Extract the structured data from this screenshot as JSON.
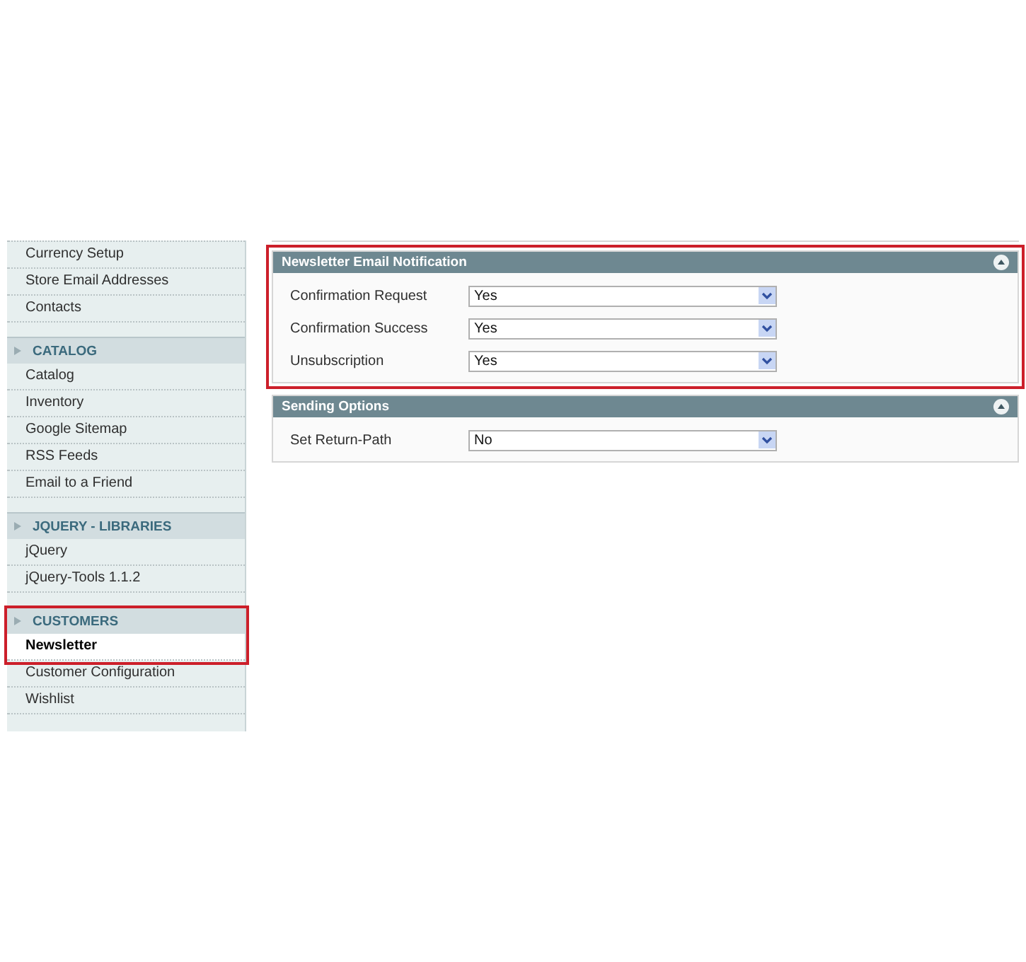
{
  "sidebar": {
    "groups": [
      {
        "items": [
          {
            "label": "Currency Setup",
            "selected": false
          },
          {
            "label": "Store Email Addresses",
            "selected": false
          },
          {
            "label": "Contacts",
            "selected": false
          }
        ]
      },
      {
        "title": "CATALOG",
        "highlighted": false,
        "items": [
          {
            "label": "Catalog",
            "selected": false
          },
          {
            "label": "Inventory",
            "selected": false
          },
          {
            "label": "Google Sitemap",
            "selected": false
          },
          {
            "label": "RSS Feeds",
            "selected": false
          },
          {
            "label": "Email to a Friend",
            "selected": false
          }
        ]
      },
      {
        "title": "JQUERY - LIBRARIES",
        "highlighted": false,
        "items": [
          {
            "label": "jQuery",
            "selected": false
          },
          {
            "label": "jQuery-Tools 1.1.2",
            "selected": false
          }
        ]
      },
      {
        "title": "CUSTOMERS",
        "highlighted": true,
        "items": [
          {
            "label": "Newsletter",
            "selected": true
          },
          {
            "label": "Customer Configuration",
            "selected": false
          },
          {
            "label": "Wishlist",
            "selected": false
          }
        ]
      }
    ]
  },
  "sections": [
    {
      "title": "Newsletter Email Notification",
      "highlighted": true,
      "fields": [
        {
          "label": "Confirmation Request",
          "value": "Yes"
        },
        {
          "label": "Confirmation Success",
          "value": "Yes"
        },
        {
          "label": "Unsubscription",
          "value": "Yes"
        }
      ]
    },
    {
      "title": "Sending Options",
      "highlighted": false,
      "fields": [
        {
          "label": "Set Return-Path",
          "value": "No"
        }
      ]
    }
  ]
}
